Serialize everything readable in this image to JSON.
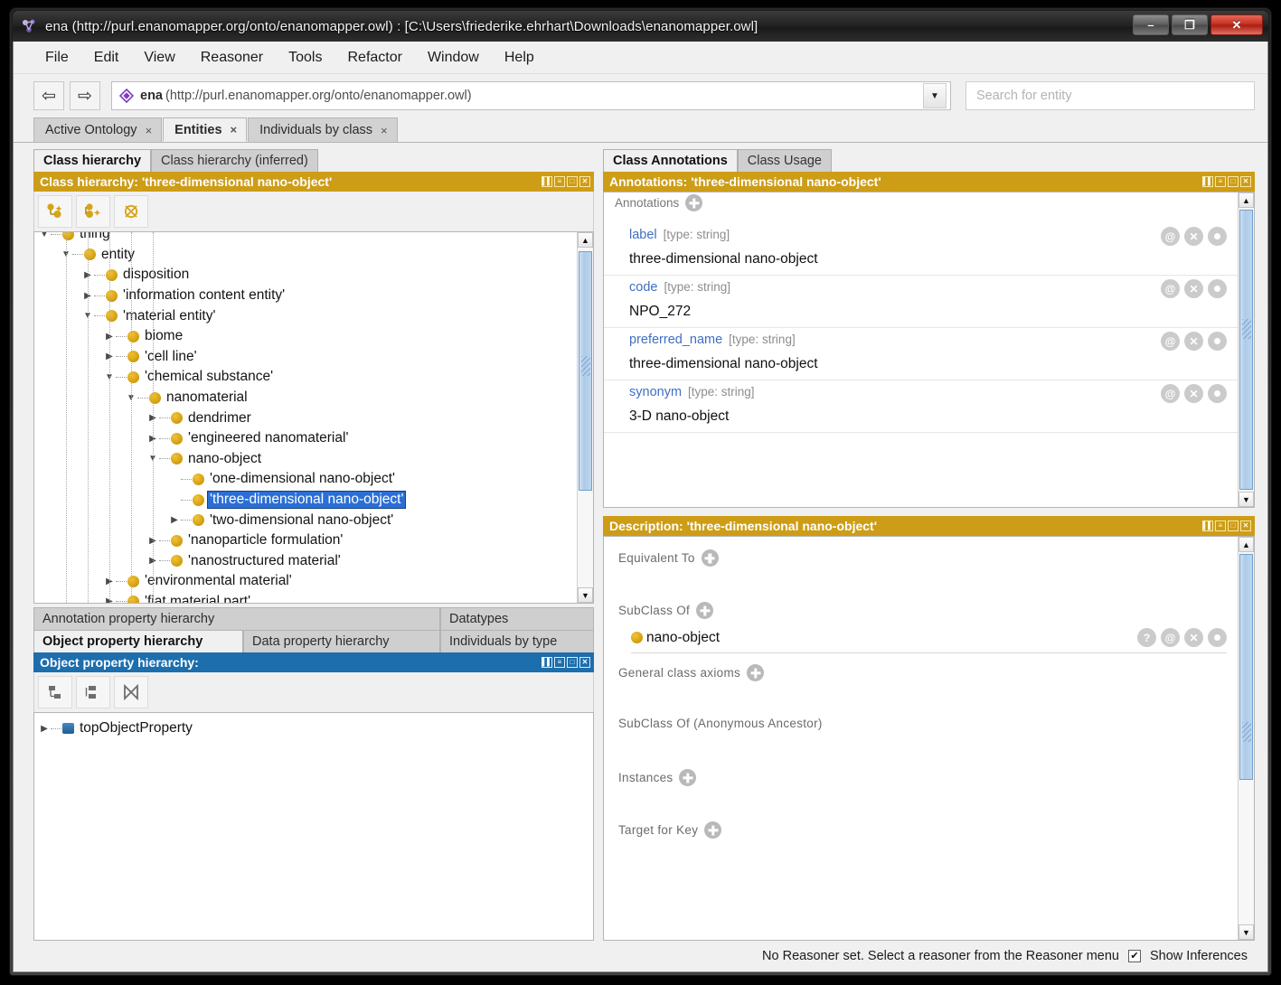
{
  "window": {
    "title": "ena (http://purl.enanomapper.org/onto/enanomapper.owl)  : [C:\\Users\\friederike.ehrhart\\Downloads\\enanomapper.owl]",
    "minimize_label": "–",
    "maximize_label": "❐",
    "close_label": "✕"
  },
  "menubar": {
    "items": [
      "File",
      "Edit",
      "View",
      "Reasoner",
      "Tools",
      "Refactor",
      "Window",
      "Help"
    ]
  },
  "navbar": {
    "back_label": "⇦",
    "forward_label": "⇨",
    "ontology_name": "ena",
    "ontology_iri": "(http://purl.enanomapper.org/onto/enanomapper.owl)",
    "combo_arrow": "▼",
    "search_placeholder": "Search for entity",
    "search_value": ""
  },
  "top_tabs": [
    {
      "label": "Active Ontology",
      "close": "×",
      "active": false
    },
    {
      "label": "Entities",
      "close": "×",
      "active": true
    },
    {
      "label": "Individuals by class",
      "close": "×",
      "active": false
    }
  ],
  "left": {
    "hierarchy_tabs": [
      {
        "label": "Class hierarchy",
        "active": true
      },
      {
        "label": "Class hierarchy (inferred)",
        "active": false
      }
    ],
    "class_header": {
      "title": "Class hierarchy: 'three-dimensional nano-object'",
      "buttons": [
        "▌▌",
        "≡",
        "□",
        "✕"
      ]
    },
    "class_toolbar": [
      {
        "name": "add-subclass-button"
      },
      {
        "name": "add-sibling-class-button"
      },
      {
        "name": "delete-class-button"
      }
    ],
    "tree": [
      {
        "label": "thing",
        "depth": 0,
        "twisty": "down",
        "clipped": true,
        "selected": false
      },
      {
        "label": "entity",
        "depth": 1,
        "twisty": "down",
        "selected": false
      },
      {
        "label": "disposition",
        "depth": 2,
        "twisty": "right",
        "selected": false
      },
      {
        "label": "'information content entity'",
        "depth": 2,
        "twisty": "right",
        "selected": false
      },
      {
        "label": "'material entity'",
        "depth": 2,
        "twisty": "down",
        "selected": false
      },
      {
        "label": "biome",
        "depth": 3,
        "twisty": "right",
        "selected": false
      },
      {
        "label": "'cell line'",
        "depth": 3,
        "twisty": "right",
        "selected": false
      },
      {
        "label": "'chemical substance'",
        "depth": 3,
        "twisty": "down",
        "selected": false
      },
      {
        "label": "nanomaterial",
        "depth": 4,
        "twisty": "down",
        "selected": false
      },
      {
        "label": "dendrimer",
        "depth": 5,
        "twisty": "right",
        "selected": false
      },
      {
        "label": "'engineered nanomaterial'",
        "depth": 5,
        "twisty": "right",
        "selected": false
      },
      {
        "label": "nano-object",
        "depth": 5,
        "twisty": "down",
        "selected": false
      },
      {
        "label": "'one-dimensional nano-object'",
        "depth": 6,
        "twisty": "none",
        "selected": false
      },
      {
        "label": "'three-dimensional nano-object'",
        "depth": 6,
        "twisty": "none",
        "selected": true
      },
      {
        "label": "'two-dimensional nano-object'",
        "depth": 6,
        "twisty": "right",
        "selected": false
      },
      {
        "label": "'nanoparticle formulation'",
        "depth": 5,
        "twisty": "right",
        "selected": false
      },
      {
        "label": "'nanostructured material'",
        "depth": 5,
        "twisty": "right",
        "selected": false
      },
      {
        "label": "'environmental material'",
        "depth": 3,
        "twisty": "right",
        "selected": false
      },
      {
        "label": "'fiat material part'",
        "depth": 3,
        "twisty": "right",
        "selected": false
      }
    ],
    "scroll_up": "▲",
    "scroll_down": "▼",
    "lower_tabs_row1": [
      {
        "label": "Annotation property hierarchy",
        "active": false
      },
      {
        "label": "Datatypes",
        "active": false
      }
    ],
    "lower_tabs_row2": [
      {
        "label": "Object property hierarchy",
        "active": true
      },
      {
        "label": "Data property hierarchy",
        "active": false
      },
      {
        "label": "Individuals by type",
        "active": false
      }
    ],
    "prop_header": {
      "title": "Object property hierarchy:",
      "buttons": [
        "▌▌",
        "≡",
        "□",
        "✕"
      ]
    },
    "prop_toolbar": [
      {
        "name": "add-sub-property-button"
      },
      {
        "name": "add-sibling-property-button"
      },
      {
        "name": "delete-property-button"
      }
    ],
    "prop_tree": [
      {
        "label": "topObjectProperty",
        "depth": 0,
        "twisty": "right"
      }
    ]
  },
  "right": {
    "tabs": [
      {
        "label": "Class Annotations",
        "active": true
      },
      {
        "label": "Class Usage",
        "active": false
      }
    ],
    "annotations_header": {
      "title": "Annotations: 'three-dimensional nano-object'",
      "buttons": [
        "▌▌",
        "≡",
        "□",
        "✕"
      ]
    },
    "annotations_label": "Annotations",
    "annotations": [
      {
        "key": "label",
        "type": "[type: string]",
        "value": "three-dimensional nano-object"
      },
      {
        "key": "code",
        "type": "[type: string]",
        "value": "NPO_272"
      },
      {
        "key": "preferred_name",
        "type": "[type: string]",
        "value": "three-dimensional nano-object"
      },
      {
        "key": "synonym",
        "type": "[type: string]",
        "value": "3-D nano-object"
      }
    ],
    "row_icons": [
      "@",
      "✕",
      "●"
    ],
    "description_header": {
      "title": "Description: 'three-dimensional nano-object'",
      "buttons": [
        "▌▌",
        "≡",
        "□",
        "✕"
      ]
    },
    "description_sections": [
      {
        "label": "Equivalent To",
        "has_plus": true,
        "items": []
      },
      {
        "label": "SubClass Of",
        "has_plus": true,
        "items": [
          {
            "label": "nano-object",
            "icons": [
              "?",
              "@",
              "✕",
              "●"
            ]
          }
        ]
      },
      {
        "label": "General class axioms",
        "has_plus": true,
        "items": []
      },
      {
        "label": "SubClass Of (Anonymous Ancestor)",
        "has_plus": false,
        "items": []
      },
      {
        "label": "Instances",
        "has_plus": true,
        "items": []
      },
      {
        "label": "Target for Key",
        "has_plus": true,
        "items": []
      }
    ],
    "scroll_up": "▲",
    "scroll_down": "▼"
  },
  "statusbar": {
    "reasoner_text": "No Reasoner set. Select a reasoner from the Reasoner menu",
    "show_inferences_label": "Show Inferences",
    "show_inferences_checked": true,
    "check_glyph": "✔"
  },
  "colors": {
    "gold_header": "#cd9d17",
    "blue_header": "#1c6ead",
    "selection_blue": "#2b6fd6",
    "class_bullet": "#d9a514",
    "property_bullet": "#1b5f96",
    "annotation_key": "#3f6fc2"
  }
}
